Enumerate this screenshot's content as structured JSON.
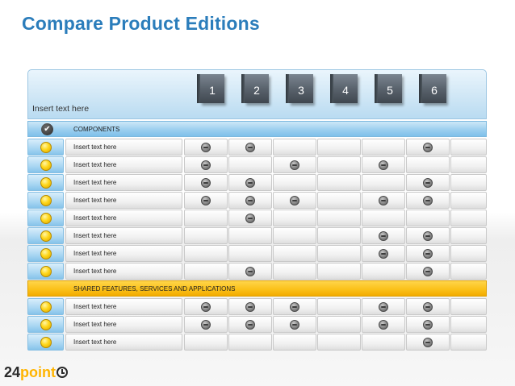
{
  "title": "Compare Product Editions",
  "header": {
    "label": "Insert text here",
    "editions": [
      "1",
      "2",
      "3",
      "4",
      "5",
      "6"
    ]
  },
  "sections": [
    {
      "name": "COMPONENTS",
      "style": "blue",
      "rows": [
        {
          "label": "Insert text here",
          "included": [
            1,
            2,
            6
          ]
        },
        {
          "label": "Insert text here",
          "included": [
            1,
            3,
            5
          ]
        },
        {
          "label": "Insert text here",
          "included": [
            1,
            2,
            6
          ]
        },
        {
          "label": "Insert text here",
          "included": [
            1,
            2,
            3,
            5,
            6
          ]
        },
        {
          "label": "Insert text here",
          "included": [
            2
          ]
        },
        {
          "label": "Insert text here",
          "included": [
            5,
            6
          ]
        },
        {
          "label": "Insert text here",
          "included": [
            5,
            6
          ]
        },
        {
          "label": "Insert text here",
          "included": [
            2,
            6
          ]
        }
      ]
    },
    {
      "name": "SHARED FEATURES, SERVICES AND APPLICATIONS",
      "style": "orange",
      "rows": [
        {
          "label": "Insert text here",
          "included": [
            1,
            2,
            3,
            5,
            6
          ]
        },
        {
          "label": "Insert text here",
          "included": [
            1,
            2,
            3,
            5,
            6
          ]
        },
        {
          "label": "Insert text here",
          "included": [
            6
          ]
        }
      ]
    }
  ],
  "colors": {
    "title": "#2b7dbb",
    "components_band": "#9ccfef",
    "shared_band": "#fbc11a",
    "included_marker": "#8c8c8c",
    "row_marker": "#ffd71a"
  },
  "logo": {
    "number": "24",
    "word": "point"
  }
}
